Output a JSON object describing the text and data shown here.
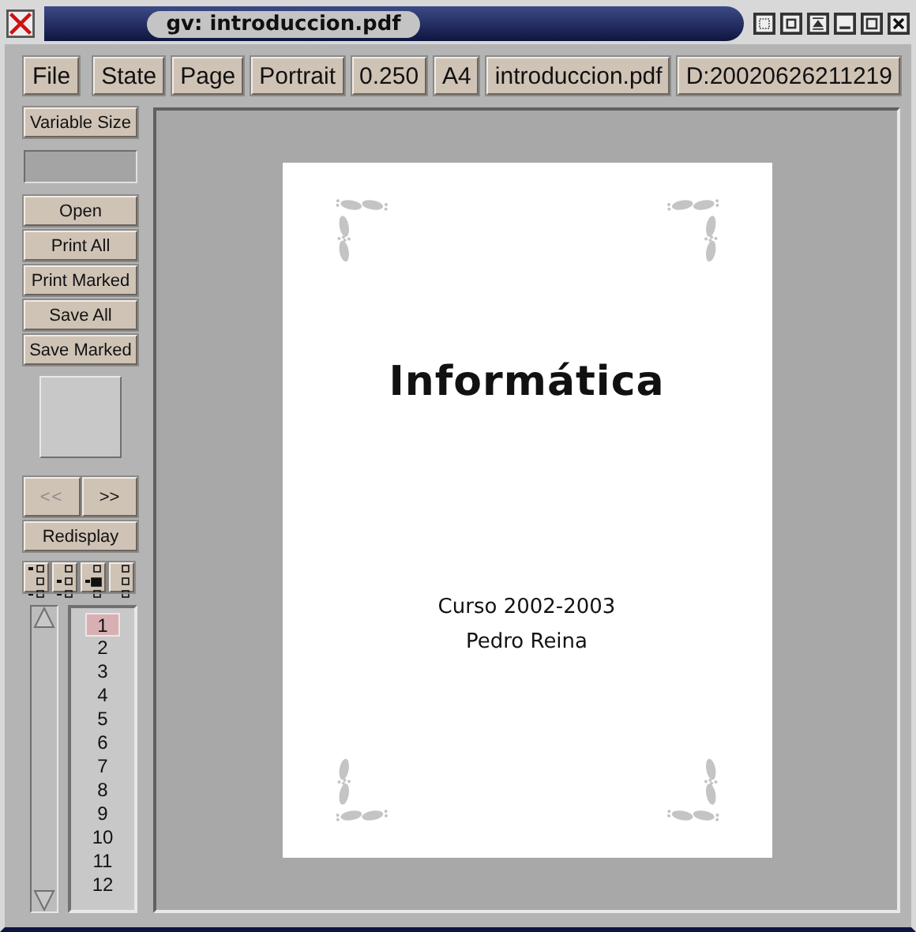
{
  "window": {
    "title": "gv: introduccion.pdf"
  },
  "toolbar": {
    "file": "File",
    "buttons": [
      "State",
      "Page",
      "Portrait",
      "0.250",
      "A4",
      "introduccion.pdf",
      "D:20020626211219"
    ]
  },
  "sidebar": {
    "size_button": "Variable Size",
    "actions": [
      "Open",
      "Print All",
      "Print Marked",
      "Save All",
      "Save Marked"
    ],
    "prev": {
      "label": "<<",
      "disabled": true
    },
    "next": {
      "label": ">>",
      "disabled": false
    },
    "redisplay": "Redisplay",
    "pages": [
      {
        "label": "1",
        "selected": true
      },
      {
        "label": "2",
        "selected": false
      },
      {
        "label": "3",
        "selected": false
      },
      {
        "label": "4",
        "selected": false
      },
      {
        "label": "5",
        "selected": false
      },
      {
        "label": "6",
        "selected": false
      },
      {
        "label": "7",
        "selected": false
      },
      {
        "label": "8",
        "selected": false
      },
      {
        "label": "9",
        "selected": false
      },
      {
        "label": "10",
        "selected": false
      },
      {
        "label": "11",
        "selected": false
      },
      {
        "label": "12",
        "selected": false
      }
    ]
  },
  "document": {
    "title": "Informática",
    "lines": [
      "Curso 2002-2003",
      "Pedro Reina"
    ]
  }
}
